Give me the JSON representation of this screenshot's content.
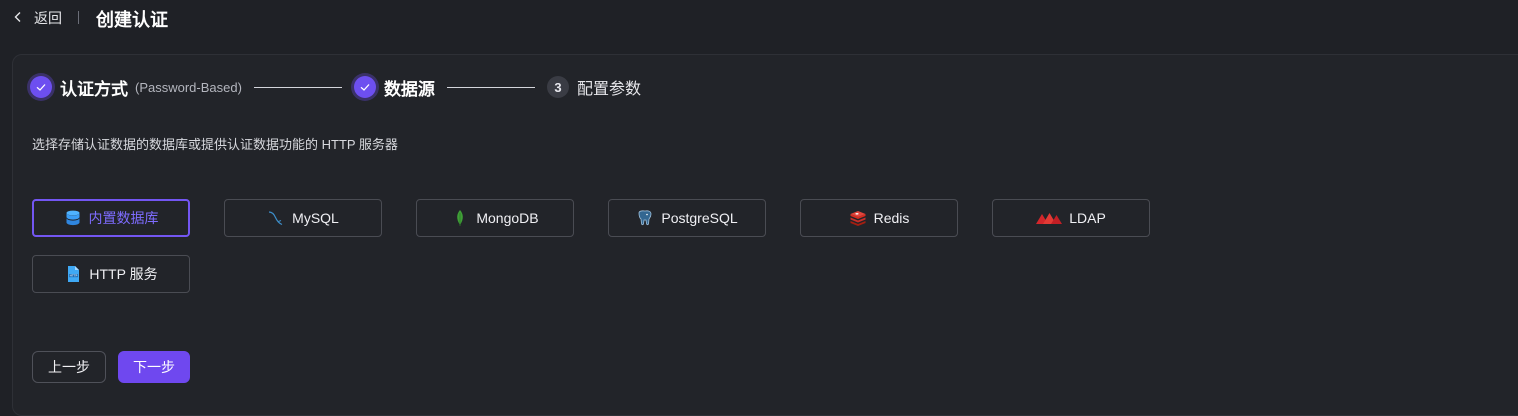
{
  "header": {
    "back_label": "返回",
    "title": "创建认证"
  },
  "steps": [
    {
      "label": "认证方式",
      "sub": "(Password-Based)",
      "state": "done"
    },
    {
      "label": "数据源",
      "state": "done"
    },
    {
      "number": "3",
      "label": "配置参数",
      "state": "todo"
    }
  ],
  "description": "选择存储认证数据的数据库或提供认证数据功能的 HTTP 服务器",
  "datasources": {
    "builtin": {
      "label": "内置数据库",
      "icon": "database-icon",
      "selected": true
    },
    "mysql": {
      "label": "MySQL",
      "icon": "mysql-icon"
    },
    "mongodb": {
      "label": "MongoDB",
      "icon": "mongodb-leaf-icon"
    },
    "postgresql": {
      "label": "PostgreSQL",
      "icon": "postgresql-elephant-icon"
    },
    "redis": {
      "label": "Redis",
      "icon": "redis-icon"
    },
    "ldap": {
      "label": "LDAP",
      "icon": "ldap-icon"
    },
    "http": {
      "label": "HTTP 服务",
      "icon": "http-file-icon"
    }
  },
  "footer": {
    "prev_label": "上一步",
    "next_label": "下一步"
  },
  "colors": {
    "background": "#1f2126",
    "accent": "#6f48ef",
    "selected_border": "#7356f2"
  }
}
